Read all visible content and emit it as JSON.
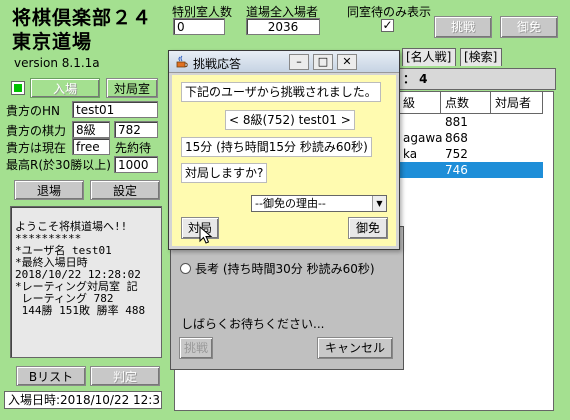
{
  "app": {
    "title_line1": "将棋倶楽部２４",
    "title_line2": "東京道場",
    "version": "version 8.1.1a"
  },
  "top": {
    "special_count_label": "特別室人数",
    "special_count_value": "0",
    "dojo_total_label": "道場全入場者",
    "dojo_total_value": "2036",
    "same_room_label": "同室待のみ表示",
    "same_room_checked": "✓",
    "challenge_button": "挑戦",
    "decline_button": "御免"
  },
  "left": {
    "enter_button": "入場",
    "game_room_button": "対局室",
    "hn_label": "貴方のHN",
    "hn_value": "test01",
    "rating_label": "貴方の棋力",
    "rating_rank": "8級",
    "rating_value": "782",
    "status_label": "貴方は現在",
    "status_value": "free",
    "first_move_value": "先約待",
    "max_r_label": "最高R(於30勝以上)",
    "max_r_value": "1000",
    "exit_button": "退場",
    "settings_button": "設定",
    "log_lines": [
      "ようこそ将棋道場へ!!",
      "**********",
      "*ユーザ名 test01",
      "*最終入場日時",
      "2018/10/22 12:28:02",
      "*レーティング対局室 記",
      " レーティング 782",
      " 144勝 151敗 勝率 488"
    ],
    "blist_button": "Bリスト",
    "judge_button": "判定",
    "entry_time": "入場日時:2018/10/22 12:3"
  },
  "tabs": {
    "multi_battle": "[名人戦]",
    "search": "[検索]"
  },
  "list": {
    "header_fragment": "： 4",
    "col_rank": "級",
    "col_points": "点数",
    "col_opponent": "対局者",
    "rows": [
      {
        "name": "",
        "points": "881"
      },
      {
        "name": "agawa",
        "points": "868"
      },
      {
        "name": "ka",
        "points": "752"
      },
      {
        "name": "",
        "points": "746"
      }
    ]
  },
  "panel2": {
    "long_game_radio": "長考 (持ち時間30分 秒読み60秒)",
    "please_wait": "しばらくお待ちください...",
    "challenge_button": "挑戦",
    "cancel_button": "キャンセル"
  },
  "dialog": {
    "title": "挑戦応答",
    "message": "下記のユーザから挑戦されました。",
    "user": "< 8級(752) test01 >",
    "time_rule": "15分 (持ち時間15分 秒読み60秒)",
    "question": "対局しますか?",
    "decline_reason_select": "--御免の理由--",
    "accept_button": "対局",
    "decline_button": "御免"
  }
}
